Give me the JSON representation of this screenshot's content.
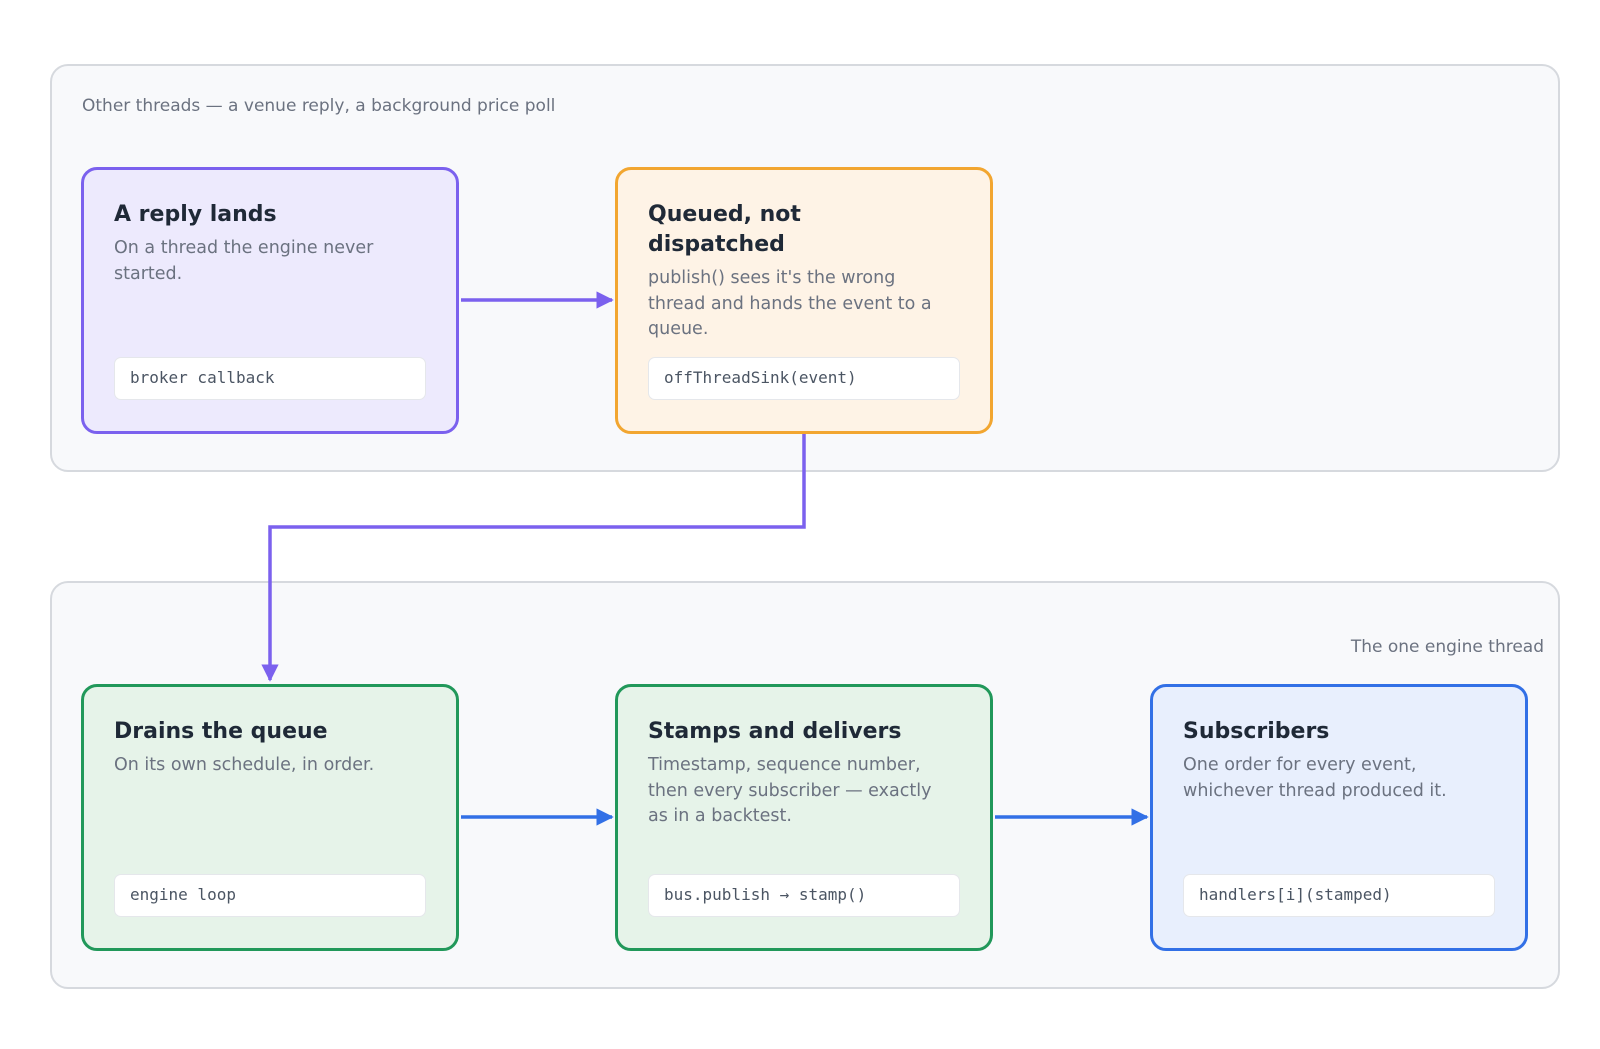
{
  "regions": {
    "top": {
      "label": "Other threads — a venue reply, a background price poll"
    },
    "bottom": {
      "label": "The one engine thread"
    }
  },
  "nodes": {
    "reply": {
      "title": "A reply lands",
      "desc": "On a thread the engine never started.",
      "code": "broker callback"
    },
    "queued": {
      "title": "Queued, not dispatched",
      "desc": "publish() sees it's the wrong thread and hands the event to a queue.",
      "code": "offThreadSink(event)"
    },
    "drain": {
      "title": "Drains the queue",
      "desc": "On its own schedule, in order.",
      "code": "engine loop"
    },
    "stamp": {
      "title": "Stamps and delivers",
      "desc": "Timestamp, sequence number, then every subscriber — exactly as in a backtest.",
      "code": "bus.publish → stamp()"
    },
    "subscriber": {
      "title": "Subscribers",
      "desc": "One order for every event, whichever thread produced it.",
      "code": "handlers[i](stamped)"
    }
  },
  "colors": {
    "purple": "#7b61ee",
    "orange": "#f2a630",
    "green": "#21985a",
    "blue": "#3270e6"
  }
}
